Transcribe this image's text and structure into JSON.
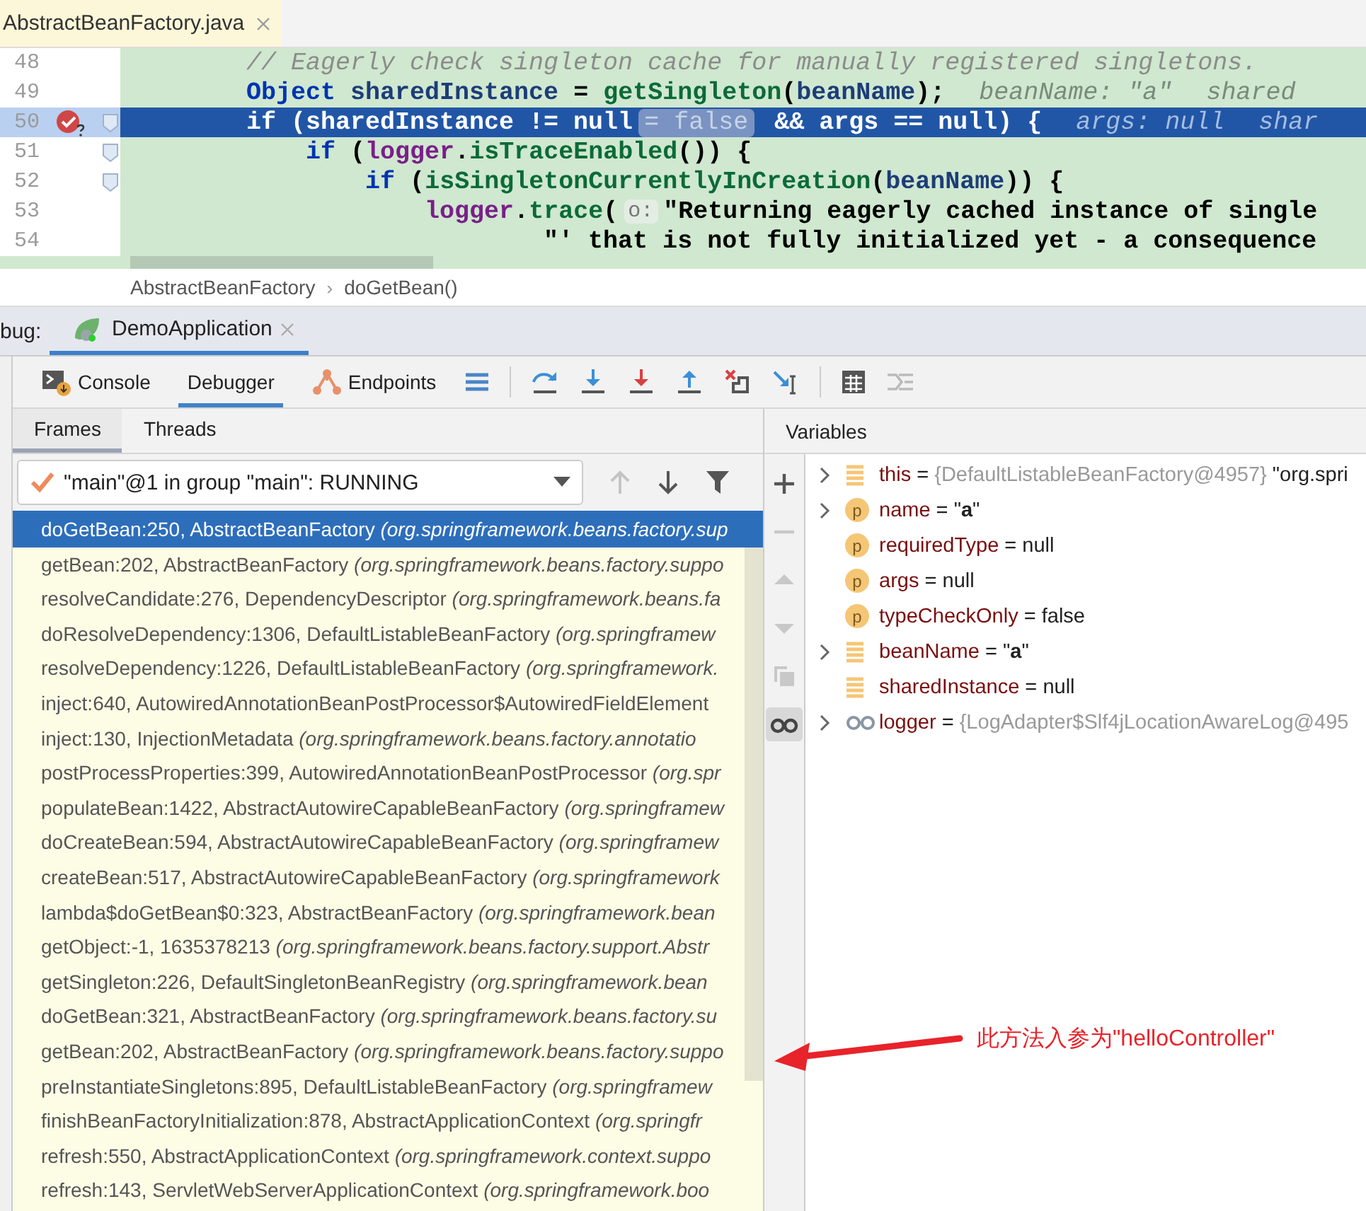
{
  "editor": {
    "tabs": [
      {
        "label": "AbstractBeanFactory.java",
        "selected": true
      }
    ],
    "lines": [
      {
        "number": "48",
        "selected": false,
        "breakpoint": false,
        "fold": false,
        "segments": [
          {
            "kind": "code",
            "parts": [
              {
                "t": "        // Eagerly check singleton cache for manually registered singletons.",
                "kind": "comment"
              }
            ]
          }
        ]
      },
      {
        "number": "49",
        "selected": false,
        "breakpoint": false,
        "fold": false,
        "segments": [
          {
            "kind": "code",
            "parts": [
              {
                "t": "        Object ",
                "kind": "keyword"
              },
              {
                "t": "sharedInstance",
                "kind": "variable"
              },
              {
                "t": " = ",
                "kind": "plain"
              },
              {
                "t": "getSingleton",
                "kind": "method"
              },
              {
                "t": "(",
                "kind": "plain"
              },
              {
                "t": "beanName",
                "kind": "variable"
              },
              {
                "t": ");",
                "kind": "plain"
              }
            ]
          },
          {
            "kind": "hint",
            "text": "beanName: \"a\""
          },
          {
            "kind": "hint",
            "text": "shared"
          }
        ]
      },
      {
        "number": "50",
        "selected": true,
        "breakpoint": true,
        "fold": true,
        "segments": [
          {
            "kind": "code",
            "parts": [
              {
                "t": "        if (sharedInstance != null",
                "kind": "plain"
              }
            ]
          },
          {
            "kind": "chip",
            "text": "= false"
          },
          {
            "kind": "code",
            "parts": [
              {
                "t": " && args == null) {",
                "kind": "plain"
              }
            ]
          },
          {
            "kind": "hint",
            "text": "args: null"
          },
          {
            "kind": "hint",
            "text": "shar"
          }
        ]
      },
      {
        "number": "51",
        "selected": false,
        "breakpoint": false,
        "fold": true,
        "segments": [
          {
            "kind": "code",
            "parts": [
              {
                "t": "            if ",
                "kind": "keyword"
              },
              {
                "t": "(",
                "kind": "plain"
              },
              {
                "t": "logger",
                "kind": "field"
              },
              {
                "t": ".",
                "kind": "plain"
              },
              {
                "t": "isTraceEnabled",
                "kind": "method"
              },
              {
                "t": "()) {",
                "kind": "plain"
              }
            ]
          }
        ]
      },
      {
        "number": "52",
        "selected": false,
        "breakpoint": false,
        "fold": true,
        "segments": [
          {
            "kind": "code",
            "parts": [
              {
                "t": "                if ",
                "kind": "keyword"
              },
              {
                "t": "(",
                "kind": "plain"
              },
              {
                "t": "isSingletonCurrentlyInCreation",
                "kind": "method"
              },
              {
                "t": "(",
                "kind": "plain"
              },
              {
                "t": "beanName",
                "kind": "variable"
              },
              {
                "t": ")) {",
                "kind": "plain"
              }
            ]
          }
        ]
      },
      {
        "number": "53",
        "selected": false,
        "breakpoint": false,
        "fold": false,
        "segments": [
          {
            "kind": "code",
            "parts": [
              {
                "t": "                    logger",
                "kind": "field"
              },
              {
                "t": ".",
                "kind": "plain"
              },
              {
                "t": "trace",
                "kind": "method"
              },
              {
                "t": "(",
                "kind": "plain"
              }
            ]
          },
          {
            "kind": "param",
            "text": "o:"
          },
          {
            "kind": "code",
            "parts": [
              {
                "t": "\"Returning eagerly cached instance of single",
                "kind": "string"
              }
            ]
          }
        ]
      },
      {
        "number": "54",
        "selected": false,
        "breakpoint": false,
        "fold": false,
        "segments": [
          {
            "kind": "code",
            "parts": [
              {
                "t": "                            \"' that is not fully initialized yet - a consequence",
                "kind": "string"
              }
            ]
          }
        ]
      }
    ],
    "breadcrumbs": [
      {
        "kind": "item",
        "text": "AbstractBeanFactory"
      },
      {
        "kind": "separator",
        "text": "›"
      },
      {
        "kind": "item",
        "text": "doGetBean()"
      }
    ]
  },
  "debug": {
    "label": "bug:",
    "sessions": [
      {
        "label": "DemoApplication",
        "selected": true
      }
    ],
    "toolbar_tabs": [
      {
        "kind": "console",
        "label": "Console",
        "selected": false
      },
      {
        "kind": "plain",
        "label": "Debugger",
        "selected": true
      },
      {
        "kind": "endpoints",
        "label": "Endpoints",
        "selected": false
      }
    ]
  },
  "frames": {
    "tabs": [
      {
        "label": "Frames",
        "selected": true
      },
      {
        "label": "Threads",
        "selected": false
      }
    ],
    "thread": {
      "value": "\"main\"@1 in group \"main\": RUNNING"
    },
    "nav": [
      {
        "kind": "up",
        "disabled": true
      },
      {
        "kind": "down",
        "disabled": false
      },
      {
        "kind": "filter",
        "disabled": false
      }
    ],
    "list": [
      {
        "method": "doGetBean:250, AbstractBeanFactory",
        "package": "(org.springframework.beans.factory.sup",
        "selected": true
      },
      {
        "method": "getBean:202, AbstractBeanFactory",
        "package": "(org.springframework.beans.factory.suppo",
        "selected": false
      },
      {
        "method": "resolveCandidate:276, DependencyDescriptor",
        "package": "(org.springframework.beans.fa",
        "selected": false
      },
      {
        "method": "doResolveDependency:1306, DefaultListableBeanFactory",
        "package": "(org.springframew",
        "selected": false
      },
      {
        "method": "resolveDependency:1226, DefaultListableBeanFactory",
        "package": "(org.springframework.",
        "selected": false
      },
      {
        "method": "inject:640, AutowiredAnnotationBeanPostProcessor$AutowiredFieldElement",
        "selected": false
      },
      {
        "method": "inject:130, InjectionMetadata",
        "package": "(org.springframework.beans.factory.annotatio",
        "selected": false
      },
      {
        "method": "postProcessProperties:399, AutowiredAnnotationBeanPostProcessor",
        "package": "(org.spr",
        "selected": false
      },
      {
        "method": "populateBean:1422, AbstractAutowireCapableBeanFactory",
        "package": "(org.springframew",
        "selected": false
      },
      {
        "method": "doCreateBean:594, AbstractAutowireCapableBeanFactory",
        "package": "(org.springframew",
        "selected": false
      },
      {
        "method": "createBean:517, AbstractAutowireCapableBeanFactory",
        "package": "(org.springframework",
        "selected": false
      },
      {
        "method": "lambda$doGetBean$0:323, AbstractBeanFactory",
        "package": "(org.springframework.bean",
        "selected": false
      },
      {
        "method": "getObject:-1, 1635378213",
        "package": "(org.springframework.beans.factory.support.Abstr",
        "selected": false
      },
      {
        "method": "getSingleton:226, DefaultSingletonBeanRegistry",
        "package": "(org.springframework.bean",
        "selected": false
      },
      {
        "method": "doGetBean:321, AbstractBeanFactory",
        "package": "(org.springframework.beans.factory.su",
        "selected": false
      },
      {
        "method": "getBean:202, AbstractBeanFactory",
        "package": "(org.springframework.beans.factory.suppo",
        "selected": false
      },
      {
        "method": "preInstantiateSingletons:895, DefaultListableBeanFactory",
        "package": "(org.springframew",
        "selected": false
      },
      {
        "method": "finishBeanFactoryInitialization:878, AbstractApplicationContext",
        "package": "(org.springfr",
        "selected": false
      },
      {
        "method": "refresh:550, AbstractApplicationContext",
        "package": "(org.springframework.context.suppo",
        "selected": false
      },
      {
        "method": "refresh:143, ServletWebServerApplicationContext",
        "package": "(org.springframework.boo",
        "selected": false
      }
    ]
  },
  "variables": {
    "title": "Variables",
    "side_toolbar": [
      {
        "kind": "add",
        "disabled": false,
        "on": false
      },
      {
        "kind": "remove",
        "disabled": true,
        "on": false
      },
      {
        "kind": "up",
        "disabled": true,
        "on": false
      },
      {
        "kind": "down",
        "disabled": true,
        "on": false
      },
      {
        "kind": "copy",
        "disabled": true,
        "on": false
      },
      {
        "kind": "watches",
        "disabled": false,
        "on": true
      }
    ],
    "items": [
      {
        "kind": "field",
        "expandable": true,
        "name": "this",
        "eq": "=",
        "ref": "{DefaultListableBeanFactory@4957}",
        "value": "\"org.spri"
      },
      {
        "kind": "param",
        "badge": "p",
        "expandable": true,
        "name": "name",
        "eq": "=",
        "value": "\"**a**\""
      },
      {
        "kind": "param",
        "badge": "p",
        "expandable": false,
        "name": "requiredType",
        "eq": "=",
        "value": "null"
      },
      {
        "kind": "param",
        "badge": "p",
        "expandable": false,
        "name": "args",
        "eq": "=",
        "value": "null"
      },
      {
        "kind": "param",
        "badge": "p",
        "expandable": false,
        "name": "typeCheckOnly",
        "eq": "=",
        "value": "false"
      },
      {
        "kind": "field",
        "expandable": true,
        "name": "beanName",
        "eq": "=",
        "value": "\"**a**\""
      },
      {
        "kind": "field",
        "expandable": false,
        "name": "sharedInstance",
        "eq": "=",
        "value": "null"
      },
      {
        "kind": "watch",
        "expandable": true,
        "name": "logger",
        "eq": "=",
        "ref": "{LogAdapter$Slf4jLocationAwareLog@495"
      }
    ]
  },
  "annotation": {
    "text": "此方法入参为\"helloController\""
  }
}
